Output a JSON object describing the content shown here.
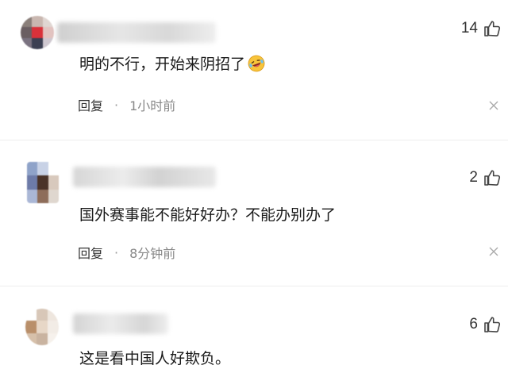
{
  "comments": [
    {
      "text": "明的不行，开始来阴招了",
      "emoji": "laughing-crying-emoji",
      "likes": "14",
      "reply_label": "回复",
      "separator": "·",
      "time": "1小时前"
    },
    {
      "text": "国外赛事能不能好好办？不能办别办了",
      "likes": "2",
      "reply_label": "回复",
      "separator": "·",
      "time": "8分钟前"
    },
    {
      "text": "这是看中国人好欺负。",
      "likes": "6"
    }
  ],
  "colors": {
    "text": "#1a1a1a",
    "meta": "#888888",
    "icon": "#555555",
    "divider": "#eeeeee"
  }
}
